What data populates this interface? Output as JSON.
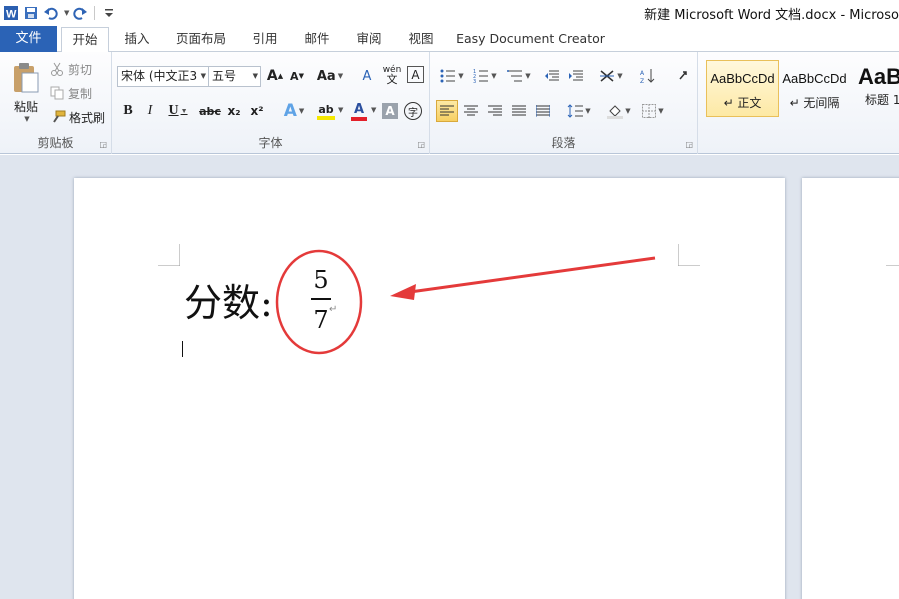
{
  "window": {
    "title": "新建 Microsoft Word 文档.docx  -  Microso"
  },
  "qat": {
    "icons": [
      "word-logo-icon",
      "save-icon",
      "undo-icon",
      "redo-icon",
      "customize-icon"
    ]
  },
  "tabs": [
    {
      "label": "文件"
    },
    {
      "label": "开始"
    },
    {
      "label": "插入"
    },
    {
      "label": "页面布局"
    },
    {
      "label": "引用"
    },
    {
      "label": "邮件"
    },
    {
      "label": "审阅"
    },
    {
      "label": "视图"
    },
    {
      "label": "Easy Document Creator"
    }
  ],
  "ribbon": {
    "clipboard": {
      "label": "剪贴板",
      "paste": "粘贴",
      "cut": "剪切",
      "copy": "复制",
      "format_painter": "格式刷"
    },
    "font": {
      "label": "字体",
      "font_name": "宋体 (中文正3",
      "font_size": "五号",
      "grow": "A",
      "shrink": "A",
      "case": "Aa",
      "clear": "A",
      "phonetic": "wén",
      "border": "A",
      "bold": "B",
      "italic": "I",
      "underline": "U",
      "strike": "abc",
      "sub": "x₂",
      "sup": "x²",
      "effects": "A",
      "highlight": "ab",
      "font_color": "A",
      "shade": "A",
      "enclose": "字"
    },
    "paragraph": {
      "label": "段落"
    },
    "styles": {
      "items": [
        {
          "sample": "AaBbCcDd",
          "name": "↵ 正文"
        },
        {
          "sample": "AaBbCcDd",
          "name": "↵ 无间隔"
        },
        {
          "sample": "AaB",
          "name": "标题 1"
        }
      ]
    }
  },
  "document": {
    "label_text": "分数:",
    "numerator": "5",
    "denominator": "7",
    "para_mark": "↵"
  },
  "colors": {
    "accent": "#2b63b6",
    "annotation": "#e43a3a"
  }
}
